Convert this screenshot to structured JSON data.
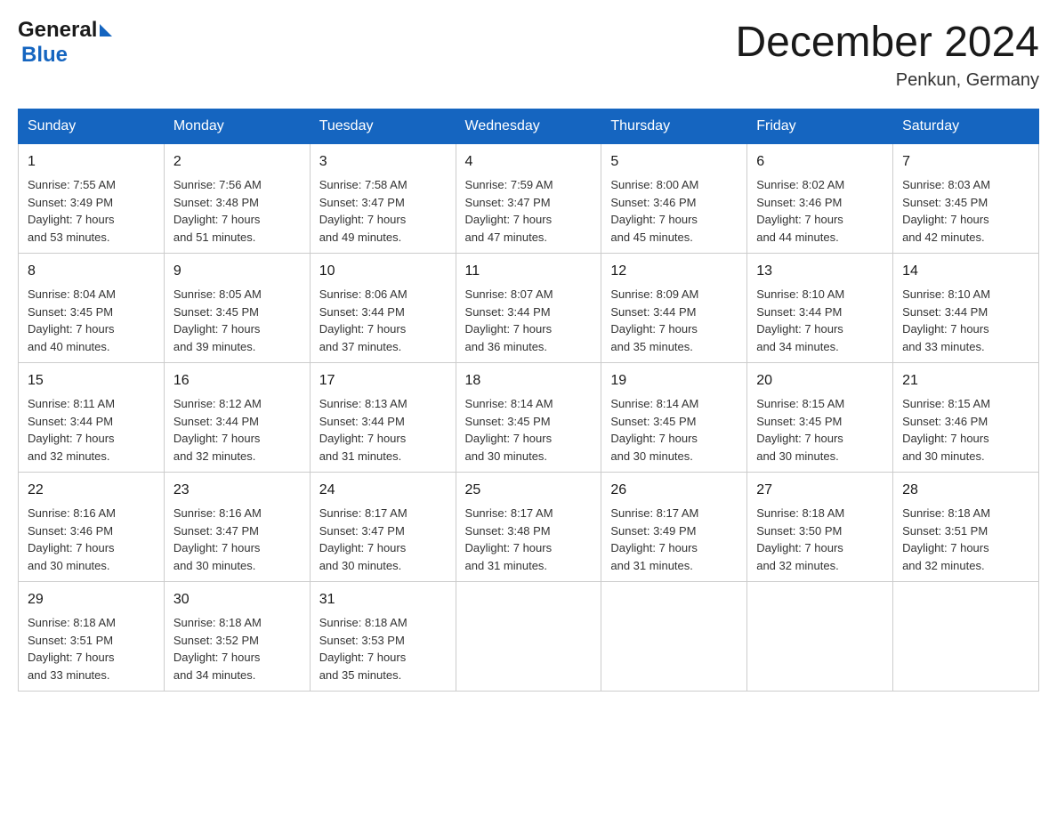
{
  "header": {
    "logo_general": "General",
    "logo_blue": "Blue",
    "month_title": "December 2024",
    "location": "Penkun, Germany"
  },
  "weekdays": [
    "Sunday",
    "Monday",
    "Tuesday",
    "Wednesday",
    "Thursday",
    "Friday",
    "Saturday"
  ],
  "weeks": [
    [
      {
        "day": "1",
        "sunrise": "7:55 AM",
        "sunset": "3:49 PM",
        "daylight": "7 hours and 53 minutes."
      },
      {
        "day": "2",
        "sunrise": "7:56 AM",
        "sunset": "3:48 PM",
        "daylight": "7 hours and 51 minutes."
      },
      {
        "day": "3",
        "sunrise": "7:58 AM",
        "sunset": "3:47 PM",
        "daylight": "7 hours and 49 minutes."
      },
      {
        "day": "4",
        "sunrise": "7:59 AM",
        "sunset": "3:47 PM",
        "daylight": "7 hours and 47 minutes."
      },
      {
        "day": "5",
        "sunrise": "8:00 AM",
        "sunset": "3:46 PM",
        "daylight": "7 hours and 45 minutes."
      },
      {
        "day": "6",
        "sunrise": "8:02 AM",
        "sunset": "3:46 PM",
        "daylight": "7 hours and 44 minutes."
      },
      {
        "day": "7",
        "sunrise": "8:03 AM",
        "sunset": "3:45 PM",
        "daylight": "7 hours and 42 minutes."
      }
    ],
    [
      {
        "day": "8",
        "sunrise": "8:04 AM",
        "sunset": "3:45 PM",
        "daylight": "7 hours and 40 minutes."
      },
      {
        "day": "9",
        "sunrise": "8:05 AM",
        "sunset": "3:45 PM",
        "daylight": "7 hours and 39 minutes."
      },
      {
        "day": "10",
        "sunrise": "8:06 AM",
        "sunset": "3:44 PM",
        "daylight": "7 hours and 37 minutes."
      },
      {
        "day": "11",
        "sunrise": "8:07 AM",
        "sunset": "3:44 PM",
        "daylight": "7 hours and 36 minutes."
      },
      {
        "day": "12",
        "sunrise": "8:09 AM",
        "sunset": "3:44 PM",
        "daylight": "7 hours and 35 minutes."
      },
      {
        "day": "13",
        "sunrise": "8:10 AM",
        "sunset": "3:44 PM",
        "daylight": "7 hours and 34 minutes."
      },
      {
        "day": "14",
        "sunrise": "8:10 AM",
        "sunset": "3:44 PM",
        "daylight": "7 hours and 33 minutes."
      }
    ],
    [
      {
        "day": "15",
        "sunrise": "8:11 AM",
        "sunset": "3:44 PM",
        "daylight": "7 hours and 32 minutes."
      },
      {
        "day": "16",
        "sunrise": "8:12 AM",
        "sunset": "3:44 PM",
        "daylight": "7 hours and 32 minutes."
      },
      {
        "day": "17",
        "sunrise": "8:13 AM",
        "sunset": "3:44 PM",
        "daylight": "7 hours and 31 minutes."
      },
      {
        "day": "18",
        "sunrise": "8:14 AM",
        "sunset": "3:45 PM",
        "daylight": "7 hours and 30 minutes."
      },
      {
        "day": "19",
        "sunrise": "8:14 AM",
        "sunset": "3:45 PM",
        "daylight": "7 hours and 30 minutes."
      },
      {
        "day": "20",
        "sunrise": "8:15 AM",
        "sunset": "3:45 PM",
        "daylight": "7 hours and 30 minutes."
      },
      {
        "day": "21",
        "sunrise": "8:15 AM",
        "sunset": "3:46 PM",
        "daylight": "7 hours and 30 minutes."
      }
    ],
    [
      {
        "day": "22",
        "sunrise": "8:16 AM",
        "sunset": "3:46 PM",
        "daylight": "7 hours and 30 minutes."
      },
      {
        "day": "23",
        "sunrise": "8:16 AM",
        "sunset": "3:47 PM",
        "daylight": "7 hours and 30 minutes."
      },
      {
        "day": "24",
        "sunrise": "8:17 AM",
        "sunset": "3:47 PM",
        "daylight": "7 hours and 30 minutes."
      },
      {
        "day": "25",
        "sunrise": "8:17 AM",
        "sunset": "3:48 PM",
        "daylight": "7 hours and 31 minutes."
      },
      {
        "day": "26",
        "sunrise": "8:17 AM",
        "sunset": "3:49 PM",
        "daylight": "7 hours and 31 minutes."
      },
      {
        "day": "27",
        "sunrise": "8:18 AM",
        "sunset": "3:50 PM",
        "daylight": "7 hours and 32 minutes."
      },
      {
        "day": "28",
        "sunrise": "8:18 AM",
        "sunset": "3:51 PM",
        "daylight": "7 hours and 32 minutes."
      }
    ],
    [
      {
        "day": "29",
        "sunrise": "8:18 AM",
        "sunset": "3:51 PM",
        "daylight": "7 hours and 33 minutes."
      },
      {
        "day": "30",
        "sunrise": "8:18 AM",
        "sunset": "3:52 PM",
        "daylight": "7 hours and 34 minutes."
      },
      {
        "day": "31",
        "sunrise": "8:18 AM",
        "sunset": "3:53 PM",
        "daylight": "7 hours and 35 minutes."
      },
      null,
      null,
      null,
      null
    ]
  ],
  "labels": {
    "sunrise": "Sunrise:",
    "sunset": "Sunset:",
    "daylight": "Daylight:"
  }
}
